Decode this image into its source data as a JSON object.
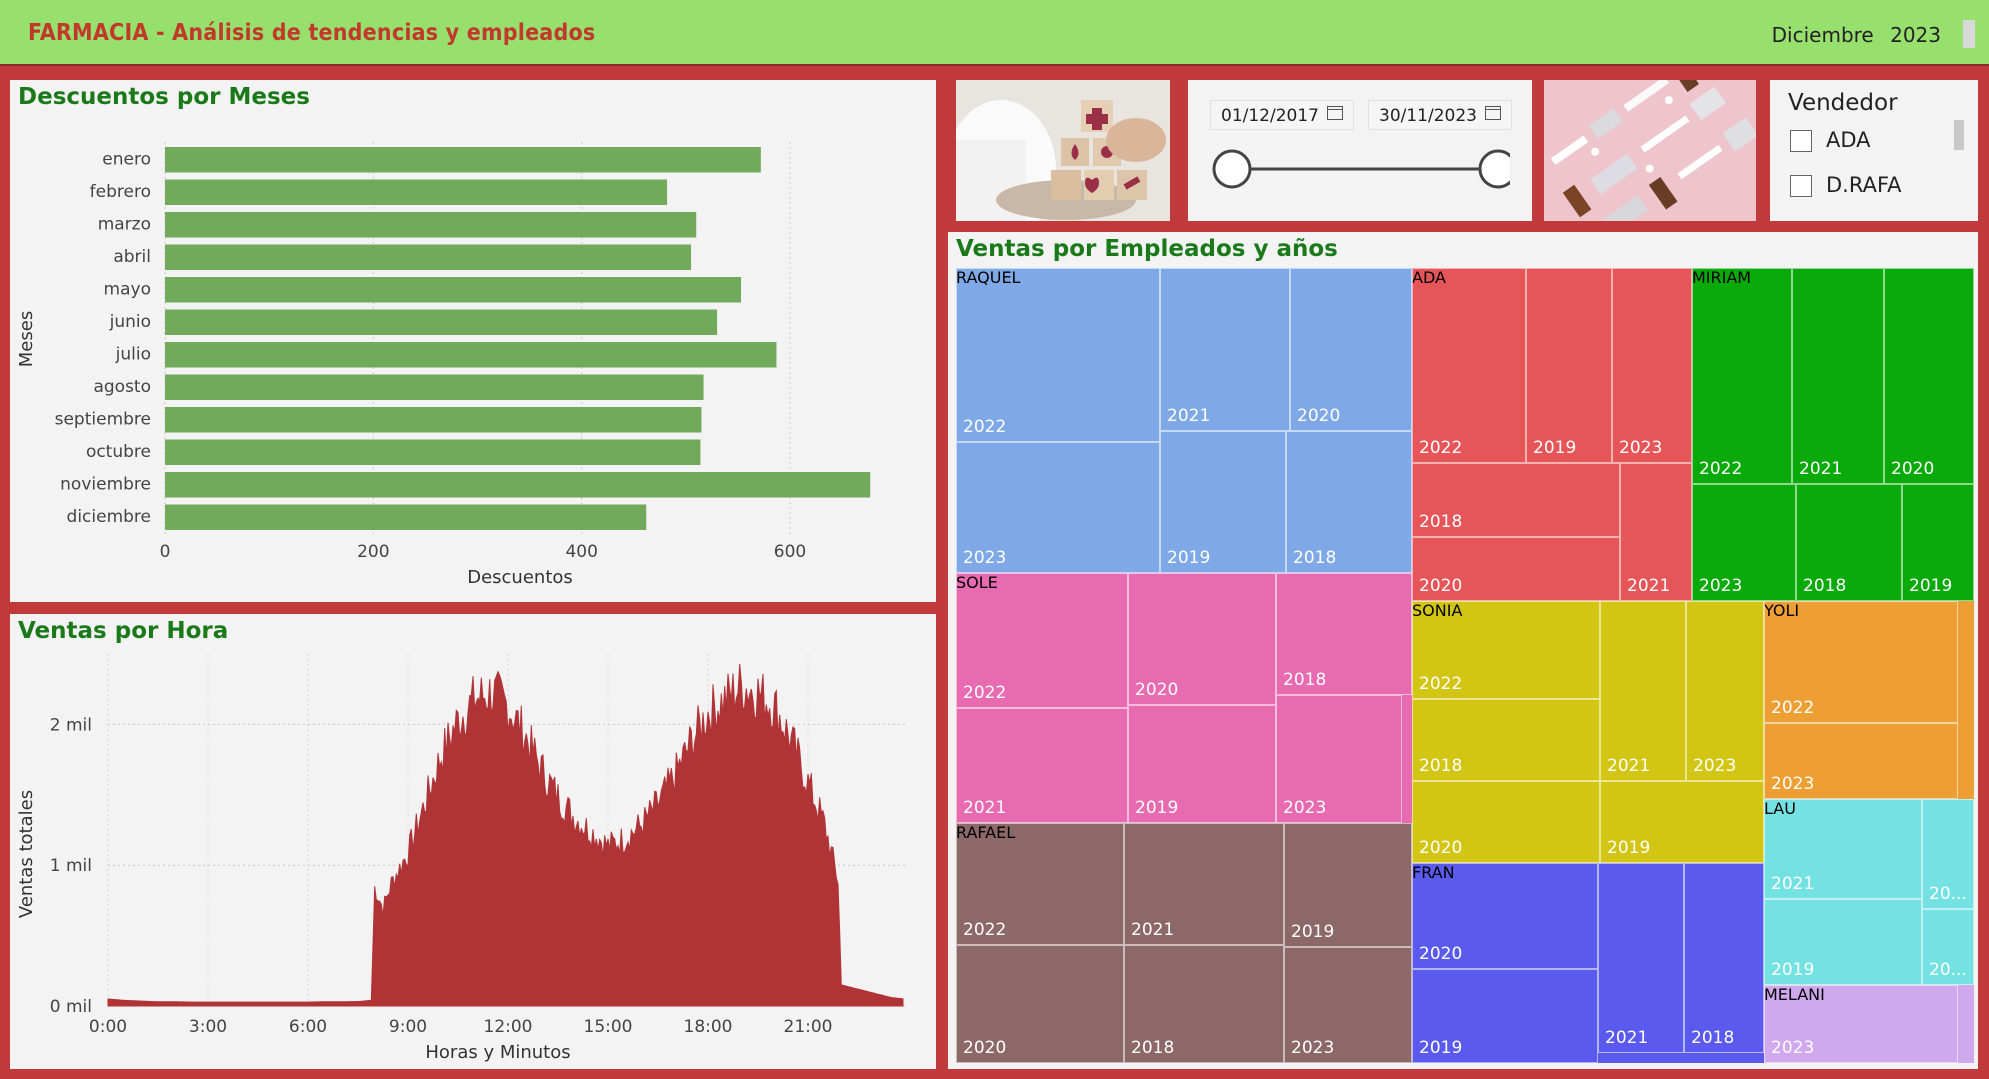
{
  "header": {
    "title": "FARMACIA - Análisis de tendencias y empleados",
    "month": "Diciembre",
    "year": "2023"
  },
  "date_range": {
    "start": "01/12/2017",
    "end": "30/11/2023"
  },
  "slicer": {
    "title": "Vendedor",
    "options": [
      "ADA",
      "D.RAFA"
    ]
  },
  "panels": {
    "descuentos_title": "Descuentos por Meses",
    "ventas_hora_title": "Ventas por Hora",
    "treemap_title": "Ventas por Empleados y años"
  },
  "chart_data": [
    {
      "type": "bar",
      "title": "Descuentos por Meses",
      "orientation": "horizontal",
      "categories": [
        "enero",
        "febrero",
        "marzo",
        "abril",
        "mayo",
        "junio",
        "julio",
        "agosto",
        "septiembre",
        "octubre",
        "noviembre",
        "diciembre"
      ],
      "values": [
        572,
        482,
        510,
        505,
        553,
        530,
        587,
        517,
        515,
        514,
        677,
        462
      ],
      "xlabel": "Descuentos",
      "ylabel": "Meses",
      "xticks": [
        0,
        200,
        400,
        600
      ],
      "xlim": [
        0,
        720
      ],
      "color": "#72aa5c",
      "grid": true
    },
    {
      "type": "area",
      "title": "Ventas por Hora",
      "xlabel": "Horas y Minutos",
      "ylabel": "Ventas totales",
      "xticks": [
        "0:00",
        "3:00",
        "6:00",
        "9:00",
        "12:00",
        "15:00",
        "18:00",
        "21:00"
      ],
      "yticks": [
        "0 mil",
        "1 mil",
        "2 mil"
      ],
      "ylim": [
        0,
        2500
      ],
      "color": "#b03336",
      "x_hours": [
        0,
        0.5,
        1,
        1.5,
        2,
        2.5,
        3,
        3.5,
        4,
        4.5,
        5,
        5.5,
        6,
        6.5,
        7,
        7.5,
        7.9,
        8.0,
        8.25,
        8.5,
        9,
        9.5,
        10,
        10.5,
        11,
        11.5,
        12,
        12.5,
        13,
        13.5,
        14,
        14.5,
        15,
        15.5,
        16,
        16.5,
        17,
        17.5,
        18,
        18.5,
        19,
        19.5,
        20,
        20.5,
        21,
        21.5,
        21.9,
        22.0,
        22.5,
        23,
        23.5,
        23.9
      ],
      "values": [
        50,
        40,
        35,
        30,
        30,
        28,
        28,
        28,
        28,
        28,
        28,
        28,
        28,
        30,
        30,
        32,
        40,
        850,
        700,
        880,
        1100,
        1450,
        1800,
        2050,
        2200,
        2250,
        2150,
        1950,
        1700,
        1500,
        1350,
        1250,
        1150,
        1200,
        1300,
        1450,
        1650,
        1900,
        2100,
        2200,
        2300,
        2250,
        2150,
        1900,
        1600,
        1300,
        900,
        150,
        120,
        90,
        60,
        50
      ],
      "grid": true
    },
    {
      "type": "treemap",
      "title": "Ventas por Empleados y años",
      "groups": [
        {
          "name": "RAQUEL",
          "color": "#7ea9e6",
          "items": [
            "2022",
            "2021",
            "2020",
            "2023",
            "2019",
            "2018"
          ]
        },
        {
          "name": "ADA",
          "color": "#e65557",
          "items": [
            "2022",
            "2019",
            "2023",
            "2018",
            "2021",
            "2020"
          ]
        },
        {
          "name": "MIRIAM",
          "color": "#0aaa0a",
          "items": [
            "2022",
            "2021",
            "2020",
            "2023",
            "2018",
            "2019"
          ]
        },
        {
          "name": "SOLE",
          "color": "#e86bb2",
          "items": [
            "2022",
            "2020",
            "2018",
            "2021",
            "2019",
            "2023"
          ]
        },
        {
          "name": "SONIA",
          "color": "#d2c513",
          "items": [
            "2022",
            "2021",
            "2023",
            "2018",
            "2020",
            "2019"
          ]
        },
        {
          "name": "YOLI",
          "color": "#ee9f33",
          "items": [
            "2022",
            "2023"
          ]
        },
        {
          "name": "RAFAEL",
          "color": "#8c6868",
          "items": [
            "2022",
            "2021",
            "2019",
            "2020",
            "2018",
            "2023"
          ]
        },
        {
          "name": "FRAN",
          "color": "#5a5aee",
          "items": [
            "2020",
            "2019",
            "2021",
            "2018"
          ]
        },
        {
          "name": "LAU",
          "color": "#74e2e2",
          "items": [
            "2021",
            "20...",
            "2019",
            "20..."
          ]
        },
        {
          "name": "MELANI",
          "color": "#d0a8ee",
          "items": [
            "2023"
          ]
        }
      ]
    }
  ]
}
